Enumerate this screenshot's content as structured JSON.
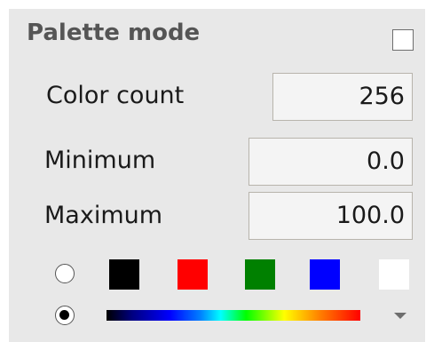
{
  "palette": {
    "title": "Palette mode",
    "enabled": false,
    "fields": {
      "color_count": {
        "label": "Color count",
        "value": "256"
      },
      "minimum": {
        "label": "Minimum",
        "value": "0.0"
      },
      "maximum": {
        "label": "Maximum",
        "value": "100.0"
      }
    },
    "solid_colors": [
      "#000000",
      "#ff0000",
      "#008000",
      "#0000ff",
      "#ffffff"
    ],
    "gradient_colors": [
      "#000000",
      "#0000ff",
      "#00ffff",
      "#00ff00",
      "#ffff00",
      "#ff8000",
      "#ff0000"
    ],
    "selected_mode": "gradient"
  }
}
